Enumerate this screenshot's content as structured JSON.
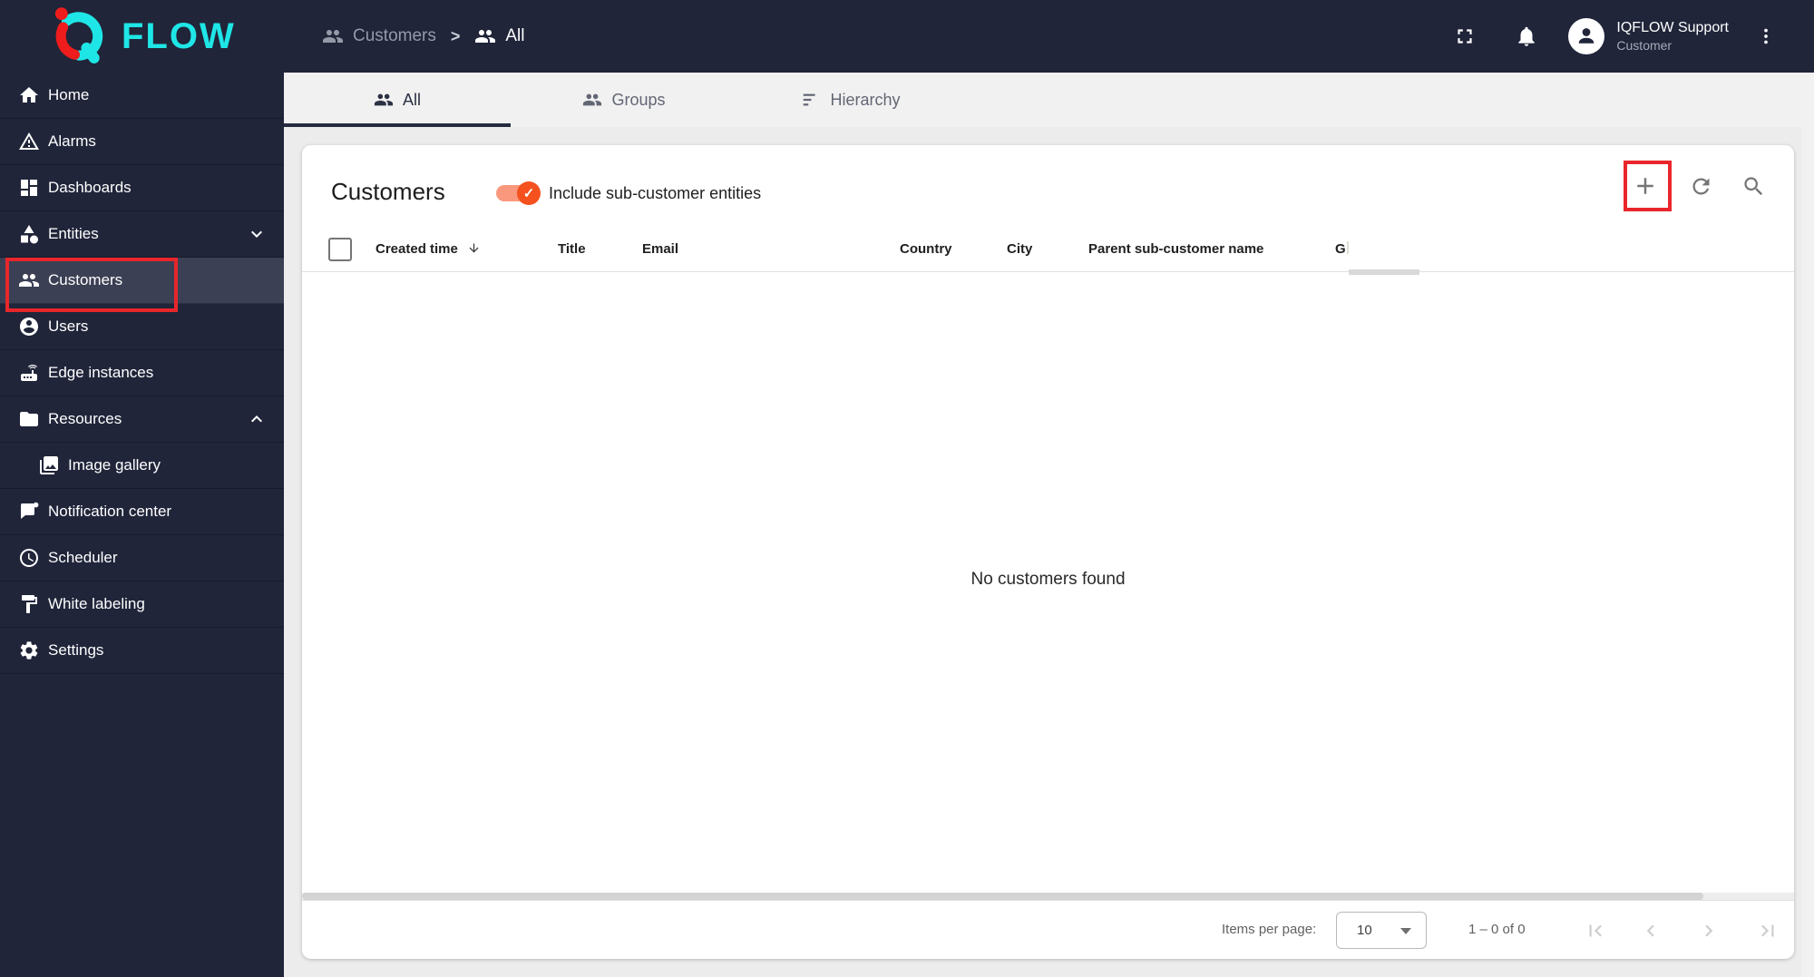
{
  "app": {
    "logo_text": "FLOW",
    "logo_mark_icon": "iq-logo-icon"
  },
  "colors": {
    "navy": "#20253a",
    "selected_nav_bg": "#3b4054",
    "logo_cyan": "#1fe6e6",
    "logo_red": "#ee1c1c",
    "accent_orange": "#f4511e",
    "toggle_track": "#f9987d",
    "annotation_red": "#e9262b",
    "page_bg": "#ececec",
    "card_bg": "#ffffff"
  },
  "header": {
    "breadcrumb": {
      "separator": ">",
      "items": [
        {
          "label": "Customers",
          "icon": "people-icon"
        },
        {
          "label": "All",
          "icon": "people-icon"
        }
      ]
    },
    "actions": [
      {
        "icon": "fullscreen-icon"
      },
      {
        "icon": "notifications-bell-icon"
      },
      {
        "icon": "kebab-menu-icon"
      }
    ],
    "user": {
      "name": "IQFLOW Support",
      "role": "Customer",
      "icon": "avatar-person-icon"
    }
  },
  "sidebar": {
    "items": [
      {
        "label": "Home",
        "icon": "home-icon"
      },
      {
        "label": "Alarms",
        "icon": "warning-triangle-icon"
      },
      {
        "label": "Dashboards",
        "icon": "dashboards-grid-icon"
      },
      {
        "label": "Entities",
        "icon": "shapes-icon",
        "chevron": "down"
      },
      {
        "label": "Customers",
        "icon": "people-icon",
        "selected": true,
        "annotated": true
      },
      {
        "label": "Users",
        "icon": "account-circle-icon"
      },
      {
        "label": "Edge instances",
        "icon": "router-icon"
      },
      {
        "label": "Resources",
        "icon": "folder-icon",
        "chevron": "up"
      },
      {
        "label": "Image gallery",
        "icon": "photo-library-icon",
        "indented": true
      },
      {
        "label": "Notification center",
        "icon": "message-badge-icon"
      },
      {
        "label": "Scheduler",
        "icon": "clock-icon"
      },
      {
        "label": "White labeling",
        "icon": "paint-roller-icon"
      },
      {
        "label": "Settings",
        "icon": "gear-icon"
      }
    ]
  },
  "tabs": {
    "items": [
      {
        "label": "All",
        "icon": "people-icon",
        "active": true
      },
      {
        "label": "Groups",
        "icon": "people-icon",
        "active": false
      },
      {
        "label": "Hierarchy",
        "icon": "hierarchy-lines-icon",
        "active": false
      }
    ]
  },
  "content": {
    "title": "Customers",
    "toggle": {
      "label": "Include sub-customer entities",
      "on": true
    },
    "actions": [
      {
        "icon": "plus-icon",
        "annotated": true
      },
      {
        "icon": "refresh-icon"
      },
      {
        "icon": "search-icon"
      }
    ],
    "columns": {
      "created_time": "Created time",
      "created_time_sort": "desc",
      "title": "Title",
      "email": "Email",
      "country": "Country",
      "city": "City",
      "parent": "Parent sub-customer name",
      "truncated": "G"
    },
    "empty_message": "No customers found"
  },
  "paginator": {
    "items_per_page_label": "Items per page:",
    "page_size": "10",
    "range": "1 – 0 of 0"
  }
}
